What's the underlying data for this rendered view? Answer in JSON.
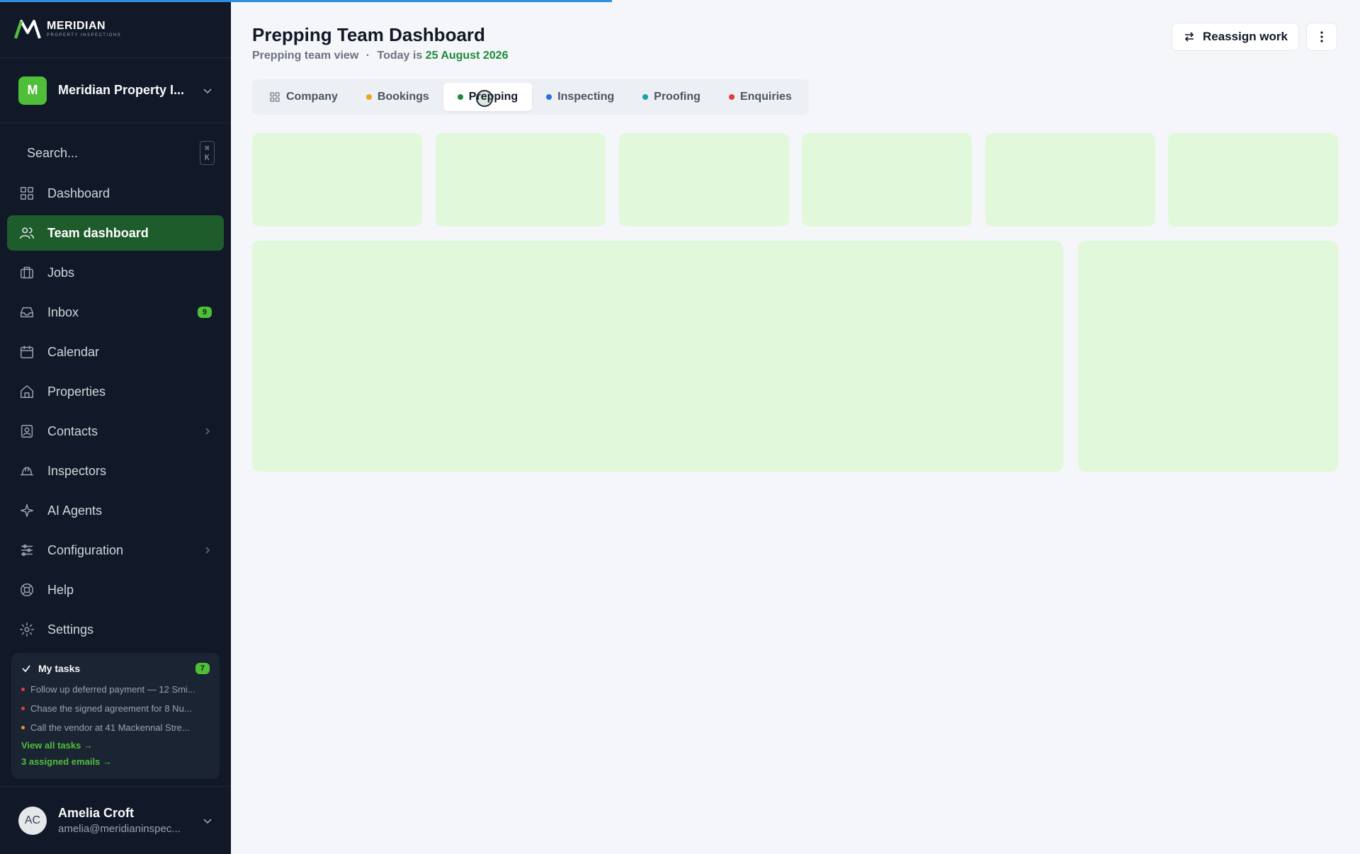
{
  "progress": {
    "fraction": 0.45
  },
  "brand": {
    "name": "MERIDIAN",
    "sub": "PROPERTY INSPECTIONS"
  },
  "org": {
    "initial": "M",
    "name": "Meridian Property I..."
  },
  "search": {
    "placeholder": "Search...",
    "shortcut": "⌘ K"
  },
  "nav": [
    {
      "label": "Dashboard",
      "icon": "grid-icon"
    },
    {
      "label": "Team dashboard",
      "icon": "users-icon",
      "active": true
    },
    {
      "label": "Jobs",
      "icon": "briefcase-icon"
    },
    {
      "label": "Inbox",
      "icon": "inbox-icon",
      "badge": "9"
    },
    {
      "label": "Calendar",
      "icon": "calendar-icon"
    },
    {
      "label": "Properties",
      "icon": "home-icon"
    },
    {
      "label": "Contacts",
      "icon": "contact-icon",
      "expandable": true
    },
    {
      "label": "Inspectors",
      "icon": "hardhat-icon"
    },
    {
      "label": "AI Agents",
      "icon": "sparkles-icon"
    },
    {
      "label": "Configuration",
      "icon": "sliders-icon",
      "expandable": true
    },
    {
      "label": "Help",
      "icon": "lifebuoy-icon"
    },
    {
      "label": "Settings",
      "icon": "gear-icon"
    }
  ],
  "tasks": {
    "title": "My tasks",
    "count": "7",
    "items": [
      {
        "text": "Follow up deferred payment — 12 Smi...",
        "color": "#e23d3d"
      },
      {
        "text": "Chase the signed agreement for 8 Nu...",
        "color": "#e23d3d"
      },
      {
        "text": "Call the vendor at 41 Mackennal Stre...",
        "color": "#e8922a"
      }
    ],
    "view_all": "View all tasks →",
    "emails": "3 assigned emails →"
  },
  "user": {
    "initials": "AC",
    "name": "Amelia Croft",
    "email": "amelia@meridianinspec..."
  },
  "header": {
    "title": "Prepping Team Dashboard",
    "subtitle_view": "Prepping team view",
    "separator": "·",
    "subtitle_today": "Today is",
    "date": "25 August 2026",
    "reassign_label": "Reassign work"
  },
  "tabs": [
    {
      "label": "Company",
      "icon": "grid-icon"
    },
    {
      "label": "Bookings",
      "color": "#f0a321"
    },
    {
      "label": "Prepping",
      "color": "#1e8a3a",
      "active": true
    },
    {
      "label": "Inspecting",
      "color": "#2f6fe0"
    },
    {
      "label": "Proofing",
      "color": "#1fa0a8"
    },
    {
      "label": "Enquiries",
      "color": "#e23d3d"
    }
  ]
}
